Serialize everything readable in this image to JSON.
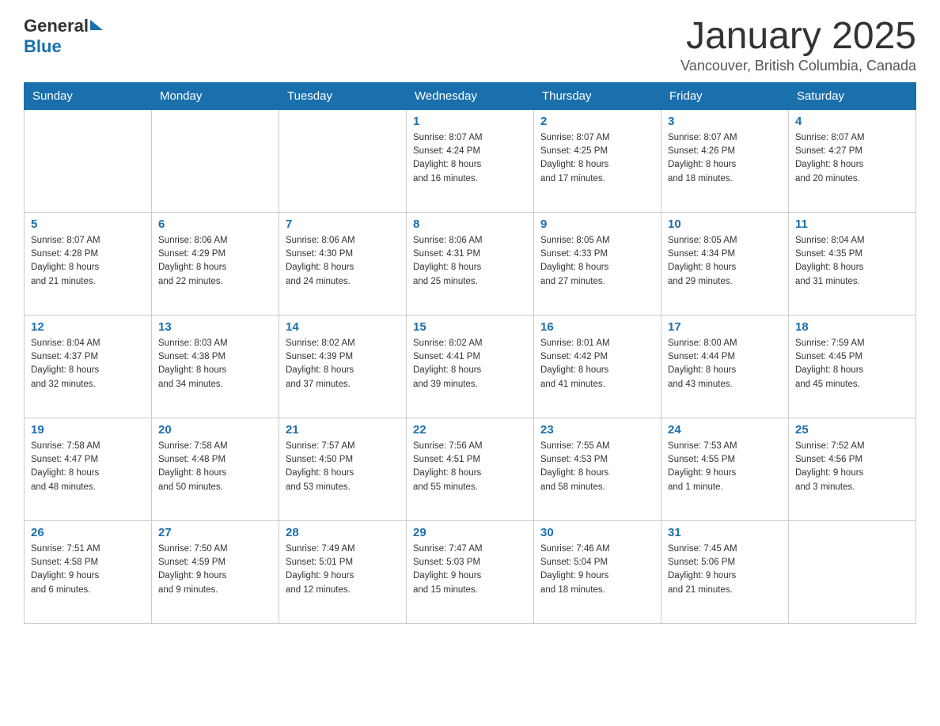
{
  "header": {
    "logo": {
      "general_text": "General",
      "blue_text": "Blue"
    },
    "title": "January 2025",
    "location": "Vancouver, British Columbia, Canada"
  },
  "calendar": {
    "days_of_week": [
      "Sunday",
      "Monday",
      "Tuesday",
      "Wednesday",
      "Thursday",
      "Friday",
      "Saturday"
    ],
    "weeks": [
      [
        {
          "day": "",
          "info": ""
        },
        {
          "day": "",
          "info": ""
        },
        {
          "day": "",
          "info": ""
        },
        {
          "day": "1",
          "info": "Sunrise: 8:07 AM\nSunset: 4:24 PM\nDaylight: 8 hours\nand 16 minutes."
        },
        {
          "day": "2",
          "info": "Sunrise: 8:07 AM\nSunset: 4:25 PM\nDaylight: 8 hours\nand 17 minutes."
        },
        {
          "day": "3",
          "info": "Sunrise: 8:07 AM\nSunset: 4:26 PM\nDaylight: 8 hours\nand 18 minutes."
        },
        {
          "day": "4",
          "info": "Sunrise: 8:07 AM\nSunset: 4:27 PM\nDaylight: 8 hours\nand 20 minutes."
        }
      ],
      [
        {
          "day": "5",
          "info": "Sunrise: 8:07 AM\nSunset: 4:28 PM\nDaylight: 8 hours\nand 21 minutes."
        },
        {
          "day": "6",
          "info": "Sunrise: 8:06 AM\nSunset: 4:29 PM\nDaylight: 8 hours\nand 22 minutes."
        },
        {
          "day": "7",
          "info": "Sunrise: 8:06 AM\nSunset: 4:30 PM\nDaylight: 8 hours\nand 24 minutes."
        },
        {
          "day": "8",
          "info": "Sunrise: 8:06 AM\nSunset: 4:31 PM\nDaylight: 8 hours\nand 25 minutes."
        },
        {
          "day": "9",
          "info": "Sunrise: 8:05 AM\nSunset: 4:33 PM\nDaylight: 8 hours\nand 27 minutes."
        },
        {
          "day": "10",
          "info": "Sunrise: 8:05 AM\nSunset: 4:34 PM\nDaylight: 8 hours\nand 29 minutes."
        },
        {
          "day": "11",
          "info": "Sunrise: 8:04 AM\nSunset: 4:35 PM\nDaylight: 8 hours\nand 31 minutes."
        }
      ],
      [
        {
          "day": "12",
          "info": "Sunrise: 8:04 AM\nSunset: 4:37 PM\nDaylight: 8 hours\nand 32 minutes."
        },
        {
          "day": "13",
          "info": "Sunrise: 8:03 AM\nSunset: 4:38 PM\nDaylight: 8 hours\nand 34 minutes."
        },
        {
          "day": "14",
          "info": "Sunrise: 8:02 AM\nSunset: 4:39 PM\nDaylight: 8 hours\nand 37 minutes."
        },
        {
          "day": "15",
          "info": "Sunrise: 8:02 AM\nSunset: 4:41 PM\nDaylight: 8 hours\nand 39 minutes."
        },
        {
          "day": "16",
          "info": "Sunrise: 8:01 AM\nSunset: 4:42 PM\nDaylight: 8 hours\nand 41 minutes."
        },
        {
          "day": "17",
          "info": "Sunrise: 8:00 AM\nSunset: 4:44 PM\nDaylight: 8 hours\nand 43 minutes."
        },
        {
          "day": "18",
          "info": "Sunrise: 7:59 AM\nSunset: 4:45 PM\nDaylight: 8 hours\nand 45 minutes."
        }
      ],
      [
        {
          "day": "19",
          "info": "Sunrise: 7:58 AM\nSunset: 4:47 PM\nDaylight: 8 hours\nand 48 minutes."
        },
        {
          "day": "20",
          "info": "Sunrise: 7:58 AM\nSunset: 4:48 PM\nDaylight: 8 hours\nand 50 minutes."
        },
        {
          "day": "21",
          "info": "Sunrise: 7:57 AM\nSunset: 4:50 PM\nDaylight: 8 hours\nand 53 minutes."
        },
        {
          "day": "22",
          "info": "Sunrise: 7:56 AM\nSunset: 4:51 PM\nDaylight: 8 hours\nand 55 minutes."
        },
        {
          "day": "23",
          "info": "Sunrise: 7:55 AM\nSunset: 4:53 PM\nDaylight: 8 hours\nand 58 minutes."
        },
        {
          "day": "24",
          "info": "Sunrise: 7:53 AM\nSunset: 4:55 PM\nDaylight: 9 hours\nand 1 minute."
        },
        {
          "day": "25",
          "info": "Sunrise: 7:52 AM\nSunset: 4:56 PM\nDaylight: 9 hours\nand 3 minutes."
        }
      ],
      [
        {
          "day": "26",
          "info": "Sunrise: 7:51 AM\nSunset: 4:58 PM\nDaylight: 9 hours\nand 6 minutes."
        },
        {
          "day": "27",
          "info": "Sunrise: 7:50 AM\nSunset: 4:59 PM\nDaylight: 9 hours\nand 9 minutes."
        },
        {
          "day": "28",
          "info": "Sunrise: 7:49 AM\nSunset: 5:01 PM\nDaylight: 9 hours\nand 12 minutes."
        },
        {
          "day": "29",
          "info": "Sunrise: 7:47 AM\nSunset: 5:03 PM\nDaylight: 9 hours\nand 15 minutes."
        },
        {
          "day": "30",
          "info": "Sunrise: 7:46 AM\nSunset: 5:04 PM\nDaylight: 9 hours\nand 18 minutes."
        },
        {
          "day": "31",
          "info": "Sunrise: 7:45 AM\nSunset: 5:06 PM\nDaylight: 9 hours\nand 21 minutes."
        },
        {
          "day": "",
          "info": ""
        }
      ]
    ]
  }
}
